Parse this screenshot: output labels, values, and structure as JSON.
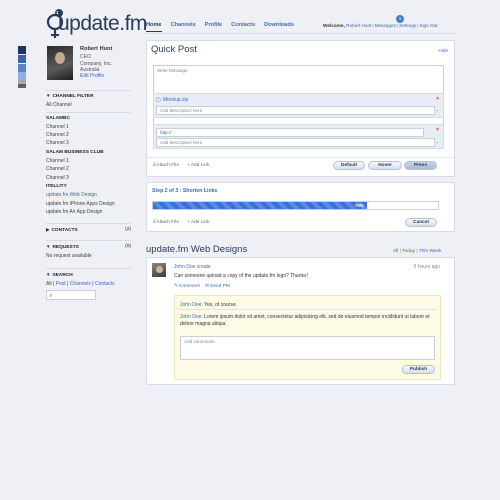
{
  "brand": {
    "logo_text": "update.fm",
    "logo_badge": "1"
  },
  "nav": {
    "items": [
      "Home",
      "Channels",
      "Profile",
      "Contacts",
      "Downloads"
    ]
  },
  "topbar": {
    "welcome": "Welcome,",
    "user": "Robert Hunt",
    "messages": "Messages",
    "messages_count": "1",
    "settings": "Settings",
    "signout": "Sign Out"
  },
  "colors": {
    "swatches": [
      "#1f3559",
      "#3766ae",
      "#5a86c9",
      "#8fb0e0",
      "#a9a9a9",
      "#5f5f5f"
    ],
    "accent": "#3a6bbd"
  },
  "profile": {
    "name": "Robert Hunt",
    "role": "CEO",
    "company": "Company, Inc.",
    "country": "Australia",
    "edit": "Edit Profile"
  },
  "sidebar": {
    "channel_filter": "CHANNEL FILTER",
    "all_channel": "All Channel",
    "group1": {
      "title": "SALAMBC",
      "items": [
        "Channel 1",
        "Channel 2",
        "Channel 3"
      ]
    },
    "group2": {
      "title": "SALAM BUSINESS CLUB",
      "items": [
        "Channel 1",
        "Channel 2",
        "Channel 3"
      ]
    },
    "group3": {
      "title": "ITELLITY",
      "items": [
        "update.fm Web Design",
        "update.fm iPhone Apps Design",
        "update.fm Air App Design"
      ]
    },
    "contacts": {
      "label": "CONTACTS",
      "count": "(2)"
    },
    "requests": {
      "label": "REQUESTS",
      "count": "(0)",
      "empty": "No request available"
    },
    "search": {
      "label": "SEARCH",
      "filters": [
        "All",
        "Post",
        "Channels",
        "Contacts"
      ]
    }
  },
  "quickpost": {
    "title": "Quick Post",
    "hide": "Hide",
    "message_placeholder": "Write Message",
    "attachment": {
      "file": "Mockup.zip",
      "desc_placeholder": "Add description here"
    },
    "link": {
      "url": "http://",
      "desc_placeholder": "Add description here"
    },
    "attach_file": "Attach File",
    "add_link": "Add Link",
    "buttons": [
      "Default",
      "Hover",
      "Press"
    ]
  },
  "shorten": {
    "title": "Step 2 of 3 : Shorten Links",
    "progress": 0.75,
    "progress_label": "75%",
    "attach_file": "Attach File",
    "add_link": "Add Link",
    "cancel": "Cancel"
  },
  "feed": {
    "title": "update.fm Web Designs",
    "filters": [
      "All",
      "Today",
      "This Week"
    ],
    "post": {
      "author": "John Doe",
      "action": "create",
      "time": "5 hours ago",
      "text": "Can someone upload a copy of the update.fm logo? Thanks!",
      "comment": "Comment",
      "send_pm": "Send PM"
    },
    "replies": [
      {
        "author": "John Doe",
        "text": ": Yes, of course."
      },
      {
        "author": "John Doe",
        "text": ": Lorem ipsum dolor sit amet, consectetur adipisicing elit, sed do eiusmod tempor incididunt ut labore et dolore magna aliqua."
      }
    ],
    "comment_placeholder": "Add comments",
    "publish": "Publish"
  }
}
